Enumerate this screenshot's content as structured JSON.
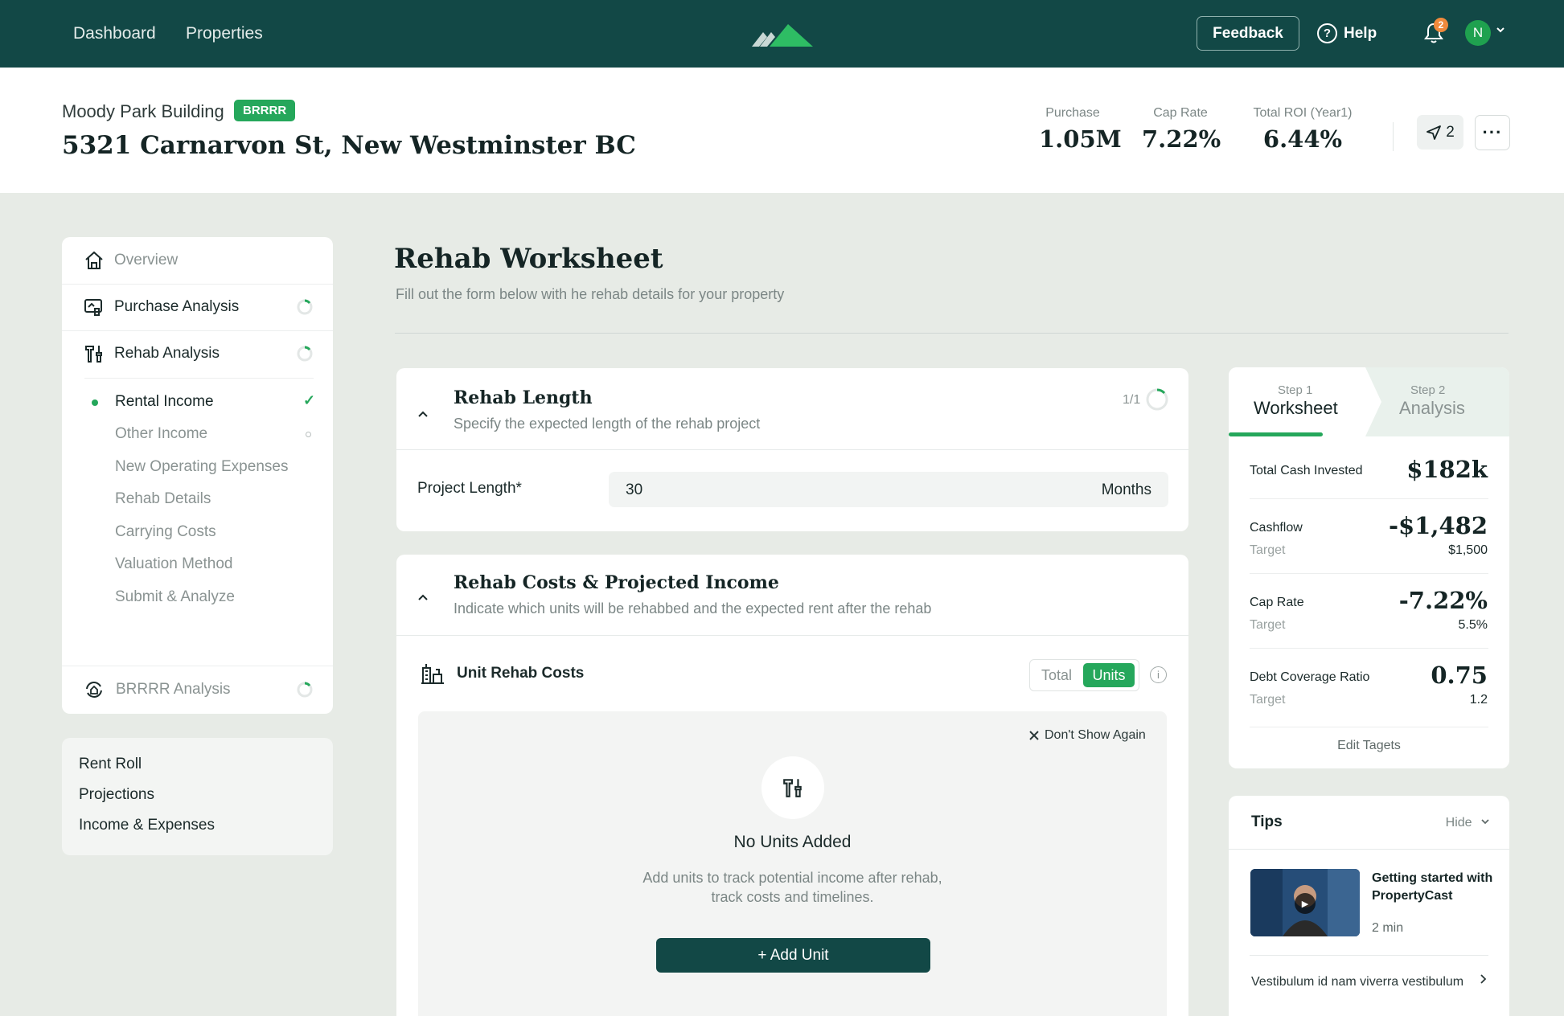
{
  "topbar": {
    "nav": [
      "Dashboard",
      "Properties"
    ],
    "feedback_label": "Feedback",
    "help_label": "Help",
    "notification_count": "2",
    "avatar_initial": "N",
    "help_glyph": "?"
  },
  "property": {
    "name": "Moody Park Building",
    "badge": "BRRRR",
    "address": "5321 Carnarvon St, New Westminster BC",
    "metrics": [
      {
        "label": "Purchase",
        "value": "1.05M"
      },
      {
        "label": "Cap Rate",
        "value": "7.22%"
      },
      {
        "label": "Total ROI (Year1)",
        "value": "6.44%"
      }
    ],
    "share_count": "2",
    "more_label": "···"
  },
  "sidebar": {
    "items": [
      {
        "label": "Overview",
        "icon": "home-icon"
      },
      {
        "label": "Purchase Analysis",
        "icon": "purchase-analysis-icon"
      },
      {
        "label": "Rehab Analysis",
        "icon": "tools-icon"
      }
    ],
    "sub_items": [
      {
        "label": "Rental Income",
        "status": "complete"
      },
      {
        "label": "Other Income",
        "status": "pending"
      },
      {
        "label": "New Operating Expenses"
      },
      {
        "label": "Rehab Details"
      },
      {
        "label": "Carrying Costs"
      },
      {
        "label": "Valuation Method"
      },
      {
        "label": "Submit & Analyze"
      }
    ],
    "brrrr": {
      "label": "BRRRR Analysis",
      "icon": "brrrr-icon"
    },
    "secondary": [
      "Rent Roll",
      "Projections",
      "Income & Expenses"
    ]
  },
  "main": {
    "title": "Rehab Worksheet",
    "subtitle": "Fill out the form below with he rehab details for your property",
    "rehab_length": {
      "title": "Rehab Length",
      "subtitle": "Specify the expected length of the rehab project",
      "counter": "1/1",
      "field_label": "Project Length*",
      "field_value": "30",
      "field_unit": "Months"
    },
    "rehab_costs": {
      "title": "Rehab Costs & Projected Income",
      "subtitle": "Indicate which units will be rehabbed and the expected rent after the rehab",
      "section_label": "Unit Rehab Costs",
      "toggle_total": "Total",
      "toggle_units": "Units",
      "info_glyph": "i",
      "dont_show": "Don't Show Again",
      "empty_title": "No Units Added",
      "empty_text_1": "Add units to track potential income after rehab,",
      "empty_text_2": "track costs and timelines.",
      "add_button": "+ Add Unit"
    }
  },
  "steps_panel": {
    "step1_small": "Step 1",
    "step1_big": "Worksheet",
    "step2_small": "Step 2",
    "step2_big": "Analysis",
    "total_cash_label": "Total Cash Invested",
    "total_cash_value": "$182k",
    "rows": [
      {
        "label": "Cashflow",
        "value": "-$1,482",
        "target_label": "Target",
        "target_value": "$1,500"
      },
      {
        "label": "Cap Rate",
        "value": "-7.22%",
        "target_label": "Target",
        "target_value": "5.5%"
      },
      {
        "label": "Debt Coverage Ratio",
        "value": "0.75",
        "target_label": "Target",
        "target_value": "1.2"
      }
    ],
    "edit_label": "Edit Tagets"
  },
  "tips": {
    "title": "Tips",
    "hide_label": "Hide",
    "video_title": "Getting started with PropertyCast",
    "video_duration": "2 min",
    "link_text": "Vestibulum id nam viverra vestibulum"
  },
  "colors": {
    "brand_dark": "#124846",
    "accent_green": "#25a75b",
    "badge_orange": "#f08a3c"
  }
}
